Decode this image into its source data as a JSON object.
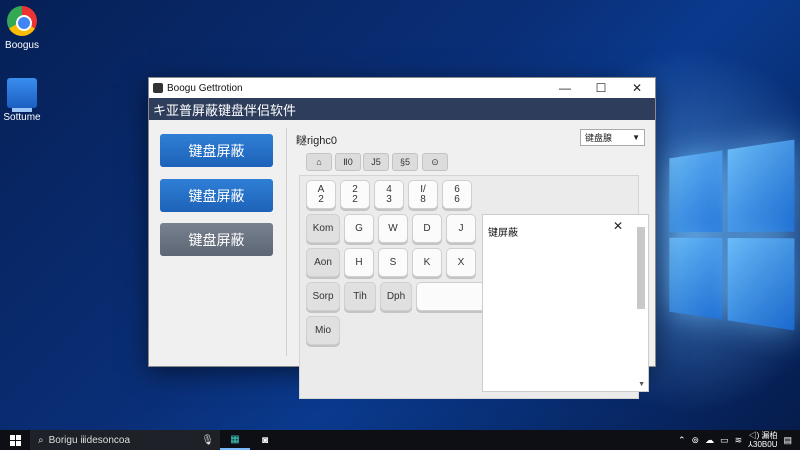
{
  "desktop": {
    "icons": [
      {
        "label": "Boogus"
      },
      {
        "label": "Sottume"
      }
    ]
  },
  "window": {
    "title": "Boogu Gettrotion",
    "controls": {
      "minimize": "—",
      "maximize": "☐",
      "close": "✕"
    },
    "menubar_title": "キ亚普屏蔽键盘伴侣软件"
  },
  "sidebar": {
    "buttons": [
      {
        "label": "键盘屏蔽"
      },
      {
        "label": "键盘屏蔽"
      },
      {
        "label": "键盘屏蔽"
      }
    ]
  },
  "keyboard_panel": {
    "label": "瞇righc0",
    "dropdown_value": "键盘腺",
    "toolbar": [
      "⌂",
      "Ⅱ0",
      "J5",
      "§5",
      "⊙"
    ],
    "keys": [
      {
        "label": "A\n2"
      },
      {
        "label": "2\n2"
      },
      {
        "label": "4\n3"
      },
      {
        "label": "I/\n8"
      },
      {
        "label": "6\n6"
      },
      {
        "label": "Kom"
      },
      {
        "label": "G"
      },
      {
        "label": "W"
      },
      {
        "label": "D"
      },
      {
        "label": "J"
      },
      {
        "label": "Aon"
      },
      {
        "label": "H"
      },
      {
        "label": "S"
      },
      {
        "label": "K"
      },
      {
        "label": "X"
      },
      {
        "label": "Sorp"
      },
      {
        "label": "Tih"
      },
      {
        "label": "Dph"
      },
      {
        "label": "Mio"
      }
    ]
  },
  "popup": {
    "title": "键屏蔽",
    "close": "✕",
    "scroll_down": "▼"
  },
  "taskbar": {
    "search_text": "Borigu ⅲdesoncoa",
    "clock_line1": "◁) 漏柏",
    "clock_line2": "⅄30B0U"
  },
  "colors": {
    "menubar": "#2e3d5c",
    "primary_button": "#2f7fd6",
    "secondary_button": "#6b7482"
  }
}
